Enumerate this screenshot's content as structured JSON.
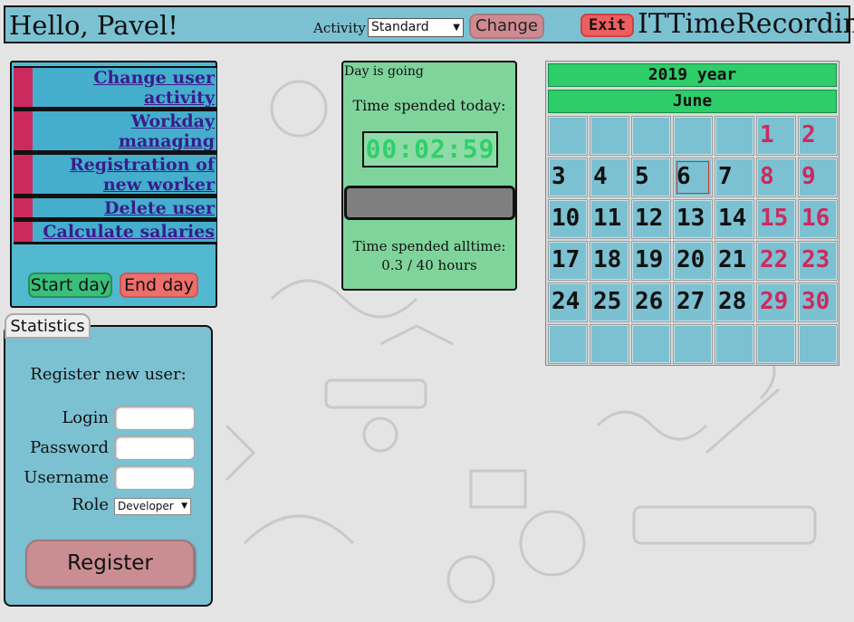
{
  "header": {
    "greeting": "Hello, Pavel!",
    "activity_label": "Activity",
    "activity_value": "Standard",
    "change_label": "Change",
    "exit_label": "Exit",
    "app_title": "ITTimeRecording"
  },
  "menu": {
    "items": [
      {
        "label_line1": "Change user",
        "label_line2": "activity"
      },
      {
        "label_line1": "Workday",
        "label_line2": "managing"
      },
      {
        "label_line1": "Registration of",
        "label_line2": "new worker"
      },
      {
        "label_line1": "Delete user",
        "label_line2": ""
      },
      {
        "label_line1": "Calculate salaries",
        "label_line2": ""
      }
    ],
    "start_day": "Start day",
    "end_day": "End day"
  },
  "statistics_tab": "Statistics",
  "register": {
    "title": "Register new user:",
    "login_label": "Login",
    "password_label": "Password",
    "username_label": "Username",
    "role_label": "Role",
    "role_value": "Developer",
    "button": "Register"
  },
  "day_panel": {
    "status": "Day is going",
    "today_label": "Time spended today:",
    "timer": "00:02:59",
    "progress_fraction": 0.0,
    "alltime_label": "Time spended alltime:",
    "alltime_value": "0.3 / 40 hours"
  },
  "calendar": {
    "year": "2019 year",
    "month": "June",
    "weeks": [
      [
        "",
        "",
        "",
        "",
        "",
        "1",
        "2"
      ],
      [
        "3",
        "4",
        "5",
        "6",
        "7",
        "8",
        "9"
      ],
      [
        "10",
        "11",
        "12",
        "13",
        "14",
        "15",
        "16"
      ],
      [
        "17",
        "18",
        "19",
        "20",
        "21",
        "22",
        "23"
      ],
      [
        "24",
        "25",
        "26",
        "27",
        "28",
        "29",
        "30"
      ],
      [
        "",
        "",
        "",
        "",
        "",
        "",
        ""
      ]
    ],
    "today": "6"
  },
  "colors": {
    "header_bg": "#7bc1d2",
    "menu_accent": "#cc2a5e",
    "timer_green": "#2fcf6a",
    "weekend_red": "#cc2a5e",
    "exit_red": "#ee5e60"
  }
}
